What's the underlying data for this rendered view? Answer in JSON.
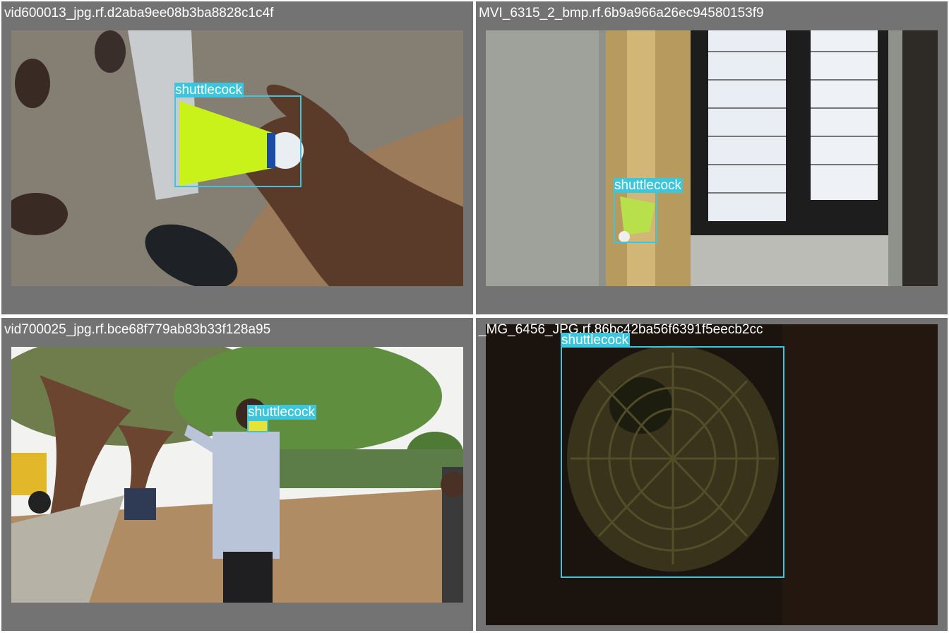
{
  "tiles": [
    {
      "title": "vid600013_jpg.rf.d2aba9ee08b3ba8828c1c4f",
      "label": "shuttlecock"
    },
    {
      "title": "MVI_6315_2_bmp.rf.6b9a966a26ec94580153f9",
      "label": "shuttlecock"
    },
    {
      "title": "vid700025_jpg.rf.bce68f779ab83b33f128a95",
      "label": "shuttlecock"
    },
    {
      "title": "_MG_6456_JPG.rf.86bc42ba56f6391f5eecb2cc",
      "label": "shuttlecock"
    }
  ],
  "colors": {
    "panel_bg": "#737373",
    "box": "#3bc6dd",
    "title_text": "#ffffff"
  }
}
